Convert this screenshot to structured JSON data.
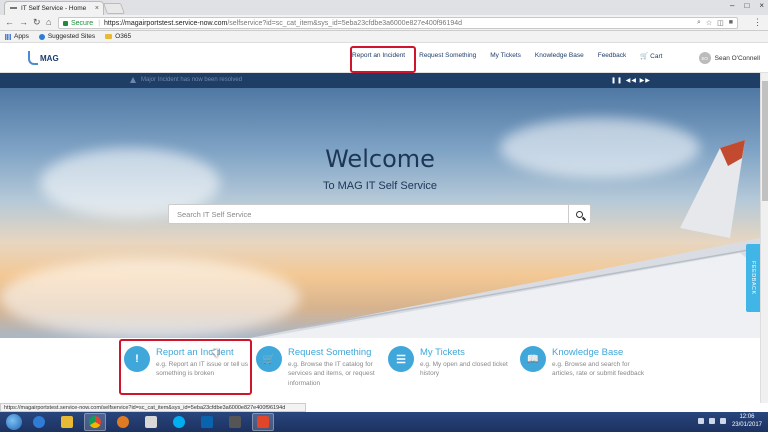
{
  "browser": {
    "tab_title": "IT Self Service - Home",
    "tab_close": "×",
    "secure_label": "Secure",
    "url_host": "https://magairportstest.service-now.com",
    "url_path": "/selfservice?id=sc_cat_item&sys_id=5eba23cfdbe3a6000e827e400f96194d",
    "bookmarks": [
      "Apps",
      "Suggested Sites",
      "O365"
    ],
    "window_controls": [
      "–",
      "□",
      "×"
    ],
    "nav_back": "←",
    "nav_forward": "→",
    "nav_reload": "↻",
    "nav_home": "⌂",
    "menu": "⋮",
    "omni_icons": [
      "⌕",
      "☆",
      "◫",
      "■"
    ]
  },
  "portal": {
    "logo_text": "MAG",
    "nav": [
      "Report an Incident",
      "Request Something",
      "My Tickets",
      "Knowledge Base",
      "Feedback",
      "Cart"
    ],
    "cart_icon": "🛒",
    "user_initials": "SO",
    "user_name": "Sean O'Connell",
    "announcement": "Major Incident has now been resolved",
    "announcement_controls": "❚❚ ◀◀ ▶▶"
  },
  "hero": {
    "title": "Welcome",
    "subtitle": "To MAG IT Self Service",
    "search_placeholder": "Search IT Self Service",
    "feedback_tab": "FEEDBACK"
  },
  "quick_links": [
    {
      "title": "Report an Incident",
      "desc": "e.g. Report an IT issue or tell us something is broken",
      "icon": "!"
    },
    {
      "title": "Request Something",
      "desc": "e.g. Browse the IT catalog for services and items, or request information",
      "icon": "🛒"
    },
    {
      "title": "My Tickets",
      "desc": "e.g. My open and closed ticket history",
      "icon": "☰"
    },
    {
      "title": "Knowledge Base",
      "desc": "e.g. Browse and search for articles, rate or submit feedback",
      "icon": "📖"
    }
  ],
  "statusbar": {
    "text": "https://magairportstest.service-now.com/selfservice?id=sc_cat_item&sys_id=5eba23cfdbe3a6000e827e400f96194d"
  },
  "taskbar": {
    "time": "12:06",
    "date": "23/01/2017"
  },
  "colors": {
    "accent": "#3fa7da",
    "navy": "#1f3e66",
    "highlight": "#d0142c"
  }
}
